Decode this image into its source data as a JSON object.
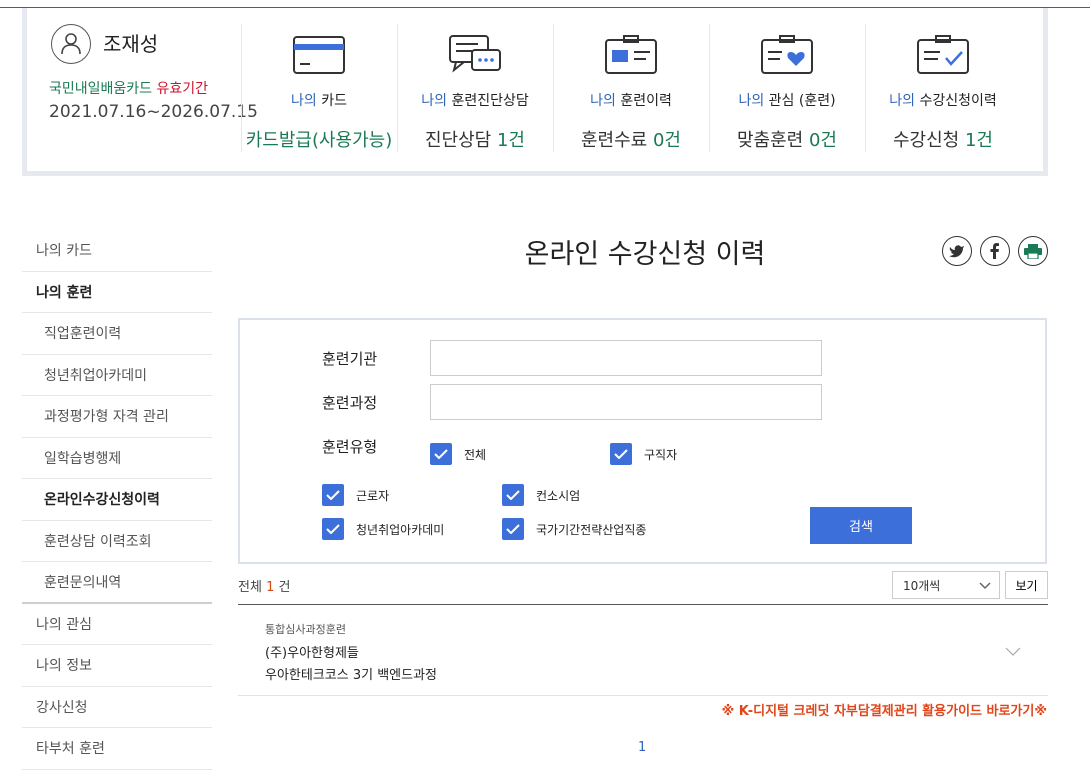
{
  "profile": {
    "name": "조재성",
    "card_label": "국민내일배움카드",
    "valid_label": "유효기간",
    "valid_period": "2021.07.16~2026.07.15"
  },
  "stats": [
    {
      "icon": "card-icon",
      "prefix": "나의",
      "label": "카드",
      "value_text": "카드발급(사용가능)",
      "value_num": ""
    },
    {
      "icon": "chat-icon",
      "prefix": "나의",
      "label": "훈련진단상담",
      "value_text": "진단상담 ",
      "value_num": "1건"
    },
    {
      "icon": "history-icon",
      "prefix": "나의",
      "label": "훈련이력",
      "value_text": "훈련수료 ",
      "value_num": "0건"
    },
    {
      "icon": "heart-card-icon",
      "prefix": "나의",
      "label": "관심 (훈련)",
      "value_text": "맞춤훈련 ",
      "value_num": "0건"
    },
    {
      "icon": "checklist-icon",
      "prefix": "나의",
      "label": "수강신청이력",
      "value_text": "수강신청 ",
      "value_num": "1건"
    }
  ],
  "sidebar": [
    {
      "label": "나의 카드",
      "kind": "item"
    },
    {
      "label": "나의 훈련",
      "kind": "head"
    },
    {
      "label": "직업훈련이력",
      "kind": "sub"
    },
    {
      "label": "청년취업아카데미",
      "kind": "sub"
    },
    {
      "label": "과정평가형 자격 관리",
      "kind": "sub"
    },
    {
      "label": "일학습병행제",
      "kind": "sub"
    },
    {
      "label": "온라인수강신청이력",
      "kind": "sub-active"
    },
    {
      "label": "훈련상담 이력조회",
      "kind": "sub"
    },
    {
      "label": "훈련문의내역",
      "kind": "sub-last"
    },
    {
      "label": "나의 관심",
      "kind": "item"
    },
    {
      "label": "나의 정보",
      "kind": "item"
    },
    {
      "label": "강사신청",
      "kind": "item"
    },
    {
      "label": "타부처 훈련",
      "kind": "item"
    }
  ],
  "page": {
    "title": "온라인 수강신청 이력",
    "social": [
      "twitter-icon",
      "facebook-icon",
      "print-icon"
    ]
  },
  "search": {
    "org_label": "훈련기관",
    "org_value": "",
    "course_label": "훈련과정",
    "course_value": "",
    "type_label": "훈련유형",
    "types": [
      {
        "label": "전체",
        "checked": true
      },
      {
        "label": "구직자",
        "checked": true
      },
      {
        "label": "근로자",
        "checked": true
      },
      {
        "label": "컨소시엄",
        "checked": true
      },
      {
        "label": "청년취업아카데미",
        "checked": true
      },
      {
        "label": "국가기간전략산업직종",
        "checked": true
      }
    ],
    "button": "검색"
  },
  "results": {
    "total_prefix": "전체",
    "total_count": "1",
    "total_suffix": "건",
    "per_page": "10개씩",
    "view_button": "보기",
    "items": [
      {
        "category": "통합심사과정훈련",
        "org": "(주)우아한형제들",
        "course": "우아한테크코스 3기 백엔드과정"
      }
    ],
    "guide_link": "※ K-디지털 크레딧 자부담결제관리 활용가이드 바로가기※",
    "page": "1"
  },
  "colors": {
    "accent": "#3d6fdb",
    "green": "#1a7a55",
    "red": "#d0112b",
    "orange": "#e0461a"
  }
}
